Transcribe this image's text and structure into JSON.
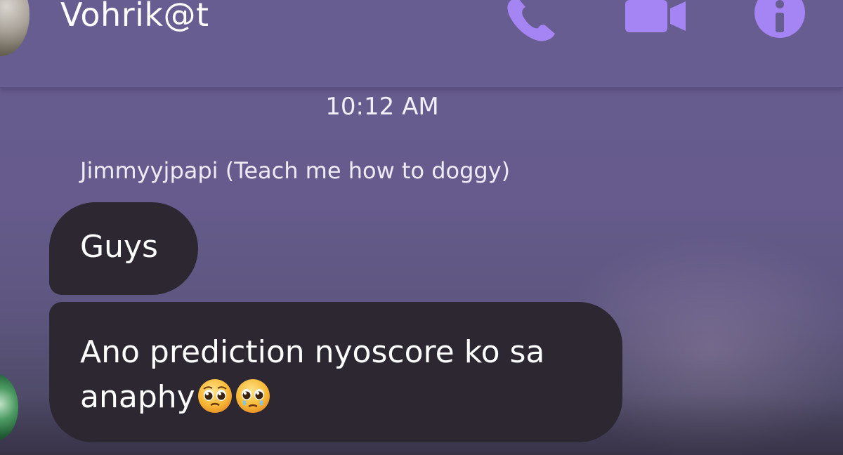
{
  "header": {
    "contact_name": "Vohrik@t",
    "icons": [
      "phone-icon",
      "video-camera-icon",
      "info-icon"
    ]
  },
  "conversation": {
    "timestamp": "10:12 AM",
    "sender_name": "Jimmyyjpapi (Teach me how to doggy)",
    "messages": [
      {
        "text": "Guys"
      },
      {
        "text_line1": "Ano prediction nyoscore ko sa",
        "text_line2": "anaphy",
        "emojis": [
          "pleading-face-icon",
          "pleading-face-icon"
        ]
      }
    ]
  },
  "colors": {
    "background": "#665b8c",
    "header": "#685d90",
    "accent": "#a584f3",
    "bubble": "#2d2732"
  }
}
